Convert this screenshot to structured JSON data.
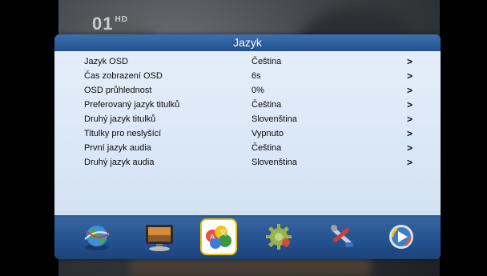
{
  "channel": {
    "logo": "01",
    "badge": "HD"
  },
  "dialog": {
    "title": "Jazyk",
    "rows": [
      {
        "label": "Jazyk OSD",
        "value": "Čeština",
        "chevron": ">"
      },
      {
        "label": "Čas zobrazení OSD",
        "value": "6s",
        "chevron": ">"
      },
      {
        "label": "OSD průhlednost",
        "value": "0%",
        "chevron": ">"
      },
      {
        "label": "Preferovaný jazyk titulků",
        "value": "Čeština",
        "chevron": ">"
      },
      {
        "label": "Druhý jazyk titulků",
        "value": "Slovenština",
        "chevron": ">"
      },
      {
        "label": "Titulky pro neslyšící",
        "value": "Vypnuto",
        "chevron": ">"
      },
      {
        "label": "První jazyk audia",
        "value": "Čeština",
        "chevron": ">"
      },
      {
        "label": "Druhý jazyk audia",
        "value": "Slovenština",
        "chevron": ">"
      }
    ]
  },
  "iconbar": {
    "icons": [
      {
        "name": "globe-network-icon"
      },
      {
        "name": "monitor-icon"
      },
      {
        "name": "language-settings-icon",
        "selected": true
      },
      {
        "name": "gear-system-icon"
      },
      {
        "name": "tools-icon"
      },
      {
        "name": "media-play-icon"
      }
    ]
  },
  "colors": {
    "header": "#2f5f9e",
    "panel": "#dde9f7",
    "selected_border": "#f2c200"
  }
}
